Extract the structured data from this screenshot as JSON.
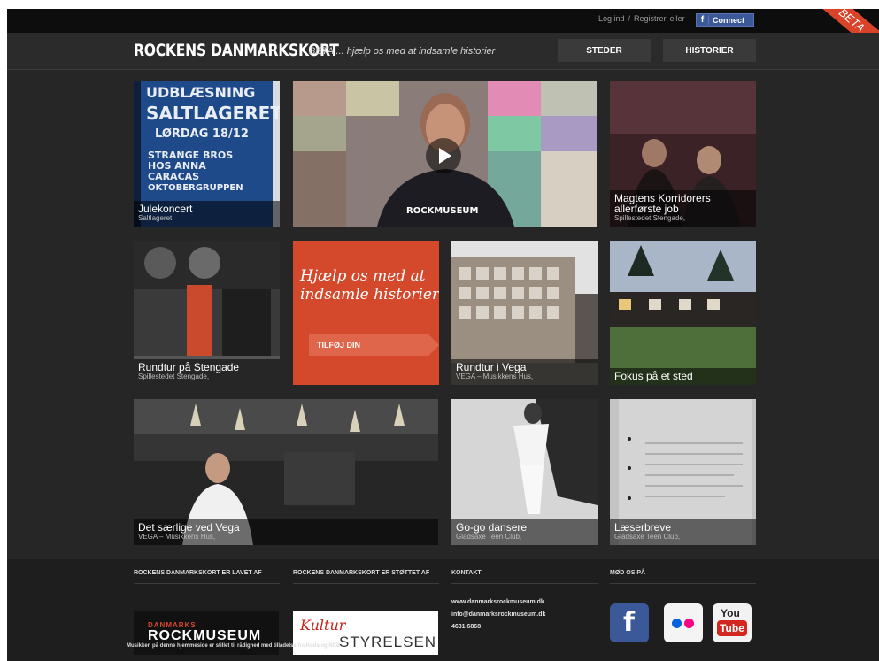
{
  "topbar": {
    "login": "Log ind",
    "sep": "/",
    "register": "Registrer",
    "or": "eller",
    "facebook_connect": "Connect",
    "beta": "BETA"
  },
  "header": {
    "logo": "ROCKENS DANMARKSKORT",
    "tagline": "BETA ... hjælp os med at indsamle historier",
    "nav": [
      "STEDER",
      "HISTORIER"
    ]
  },
  "tiles": [
    {
      "title": "Julekoncert",
      "subtitle": "Saltlageret,",
      "poster": [
        "UDBLÆSNING",
        "SALTLAGERET",
        "LØRDAG 18/12",
        "STRANGE BROS",
        "HOS ANNA",
        "CARACAS",
        "OKTOBERGRUPPEN"
      ]
    },
    {
      "title": "",
      "subtitle": "",
      "shirt": "ROCKMUSEUM"
    },
    {
      "title": "Magtens Korridorers allerførste job",
      "subtitle": "Spillestedet Stengade,"
    },
    {
      "title": "Rundtur på Stengade",
      "subtitle": "Spillestedet Stengade,"
    },
    {
      "promo_text": "Hjælp os med at indsamle historier",
      "cta": "TILFØJ DIN ROCKHISTORIE"
    },
    {
      "title": "Rundtur i Vega",
      "subtitle": "VEGA – Musikkens Hus,"
    },
    {
      "title": "Fokus på et sted",
      "subtitle": ""
    },
    {
      "title": "Det særlige ved Vega",
      "subtitle": "VEGA – Musikkens Hus,"
    },
    {
      "title": "Go-go dansere",
      "subtitle": "Gladsaxe Teen Club,"
    },
    {
      "title": "Læserbreve",
      "subtitle": "Gladsaxe Teen Club,"
    }
  ],
  "footer": {
    "col1_title": "ROCKENS DANMARKSKORT ER LAVET AF",
    "col2_title": "ROCKENS DANMARKSKORT ER STØTTET AF",
    "col3_title": "KONTAKT",
    "col4_title": "MØD OS PÅ",
    "rockmuseum_small": "DANMARKS",
    "rockmuseum_big": "ROCKMUSEUM",
    "kultur_top": "Kultur",
    "kultur_bottom": "STYRELSEN",
    "contact": [
      "www.danmarksrockmuseum.dk",
      "info@danmarksrockmuseum.dk",
      "4631 6868"
    ],
    "footnote": "Musikken på denne hjemmeside er stillet til rådighed med tilladelse fra Koda og NCB"
  },
  "social": [
    {
      "name": "Facebook",
      "glyph": "f"
    },
    {
      "name": "Flickr",
      "glyph": ""
    },
    {
      "name": "YouTube",
      "glyph_top": "You",
      "glyph_bottom": "Tube"
    }
  ]
}
